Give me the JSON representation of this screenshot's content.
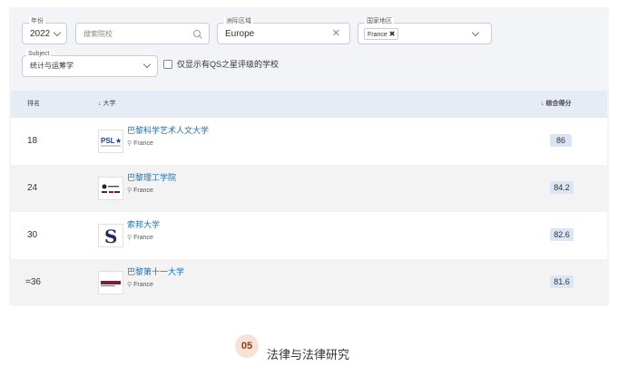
{
  "filters": {
    "year": {
      "label": "年份",
      "value": "2022"
    },
    "search": {
      "placeholder": "搜索院校"
    },
    "region": {
      "label": "洲际区域",
      "value": "Europe"
    },
    "country": {
      "label": "国家地区",
      "chip": "France"
    },
    "subject": {
      "label": "Subject",
      "value": "统计与运筹学"
    },
    "qs_stars_only": {
      "label": "仅显示有QS之星评级的学校",
      "checked": false
    }
  },
  "table": {
    "headers": {
      "rank": "排名",
      "university": "大学",
      "score": "综合得分"
    },
    "rows": [
      {
        "rank": "18",
        "name": "巴黎科学艺术人文大学",
        "location": "France",
        "score": "86",
        "logo": "psl-logo"
      },
      {
        "rank": "24",
        "name": "巴黎理工学院",
        "location": "France",
        "score": "84.2",
        "logo": "polytechnique-logo"
      },
      {
        "rank": "30",
        "name": "索邦大学",
        "location": "France",
        "score": "82.6",
        "logo": "sorbonne-logo"
      },
      {
        "rank": "=36",
        "name": "巴黎第十一大学",
        "location": "France",
        "score": "81.6",
        "logo": "paris-saclay-logo"
      }
    ]
  },
  "section": {
    "number": "05",
    "title": "法律与法律研究"
  },
  "colors": {
    "link": "#1a6fb0",
    "score_bg": "#dbe6f5",
    "header_bg": "#e6ecf6",
    "section_circle": "#f6e3d8"
  }
}
